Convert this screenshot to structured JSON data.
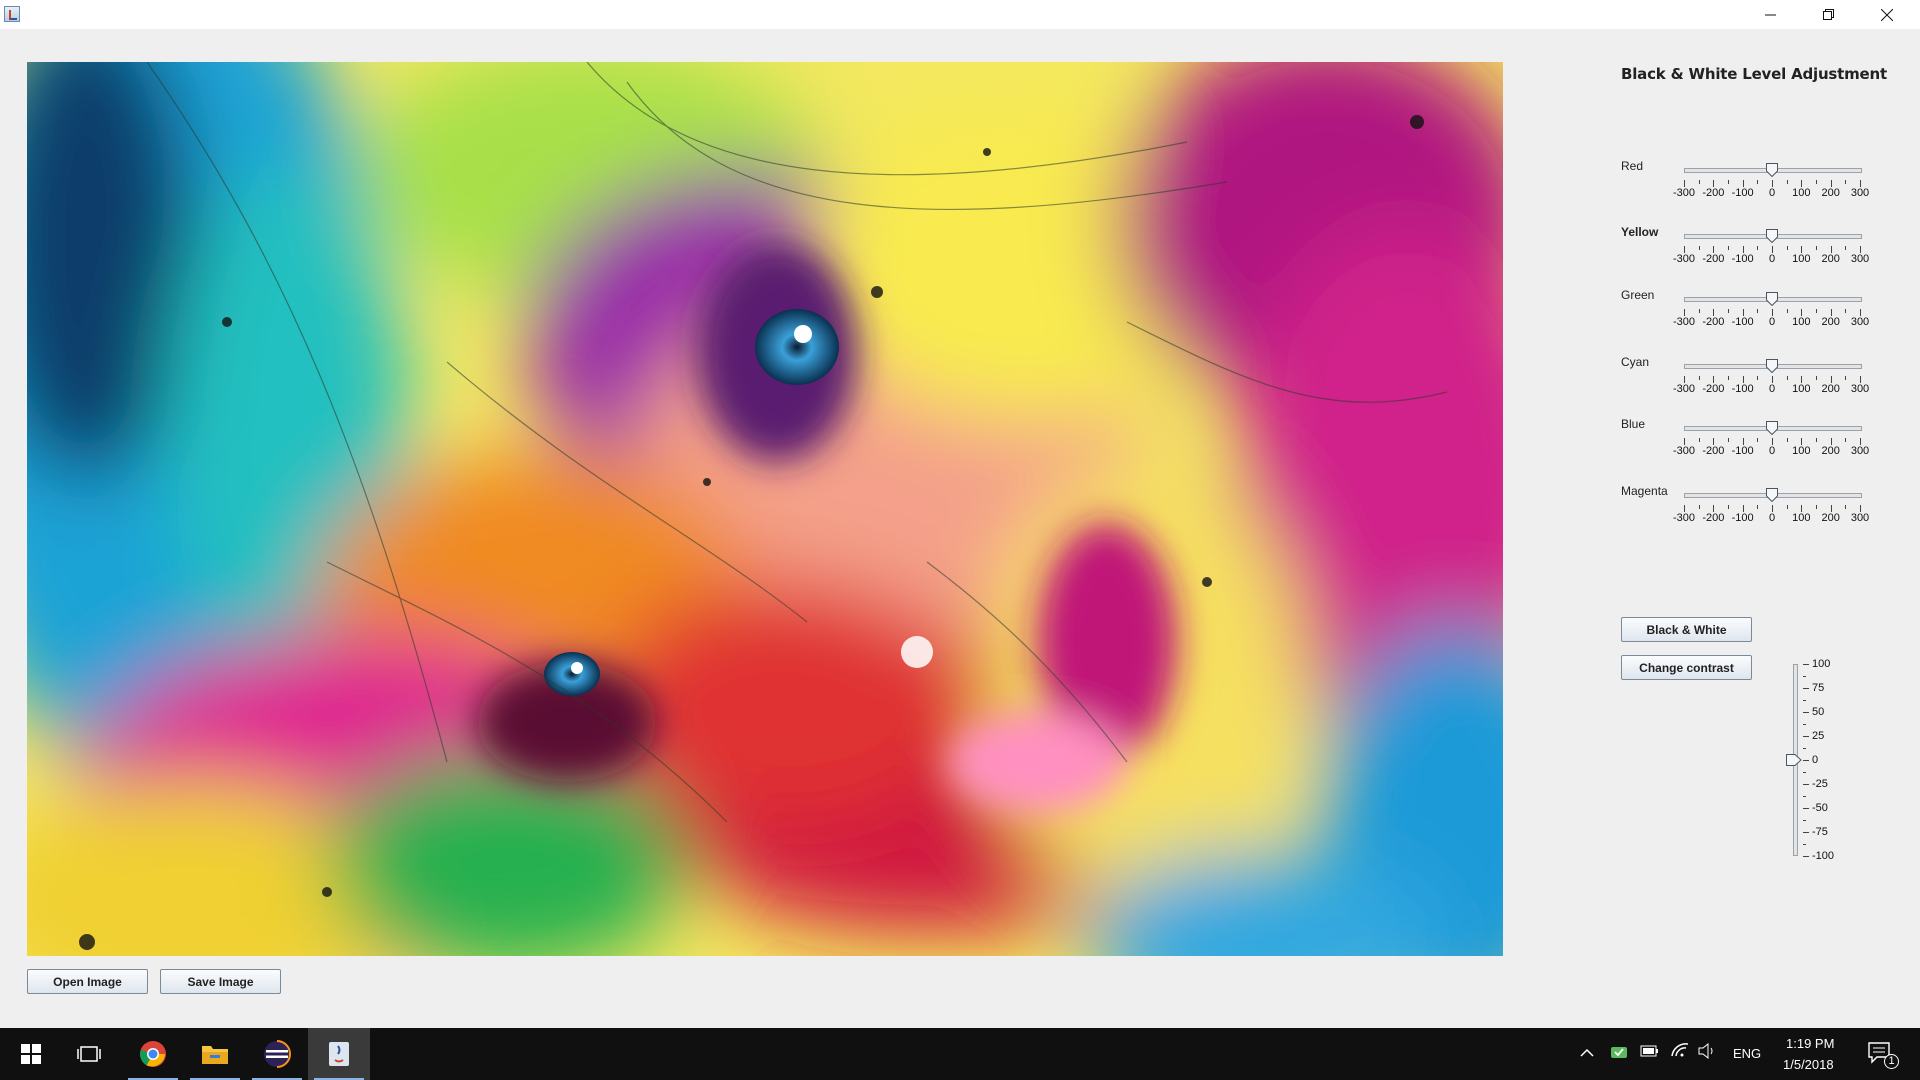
{
  "window": {
    "icon": "java-app-icon",
    "controls": [
      "minimize-icon",
      "restore-icon",
      "close-icon"
    ]
  },
  "image_view": {
    "content": "colorful watercolor portrait painting"
  },
  "bottom_buttons": {
    "open": "Open Image",
    "save": "Save Image"
  },
  "panel": {
    "title": "Black & White Level Adjustment",
    "sliders": [
      {
        "label": "Red",
        "value": 0,
        "bold": false
      },
      {
        "label": "Yellow",
        "value": 0,
        "bold": true
      },
      {
        "label": "Green",
        "value": 0,
        "bold": false
      },
      {
        "label": "Cyan",
        "value": 0,
        "bold": false
      },
      {
        "label": "Blue",
        "value": 0,
        "bold": false
      },
      {
        "label": "Magenta",
        "value": 0,
        "bold": false
      }
    ],
    "slider_min": -300,
    "slider_max": 300,
    "slider_tick_labels": [
      "-300",
      "-200",
      "-100",
      "0",
      "100",
      "200",
      "300"
    ],
    "bw_button": "Black & White",
    "contrast_button": "Change contrast",
    "contrast": {
      "value": 0,
      "min": -100,
      "max": 100,
      "tick_labels": [
        "100",
        "75",
        "50",
        "25",
        "0",
        "-25",
        "-50",
        "-75",
        "-100"
      ]
    }
  },
  "taskbar": {
    "apps": [
      "windows-start-icon",
      "task-view-icon",
      "chrome-icon",
      "file-explorer-icon",
      "eclipse-icon",
      "java-icon"
    ],
    "language": "ENG",
    "time": "1:19 PM",
    "date": "1/5/2018",
    "notification_count": "1"
  },
  "colors": {
    "accent": "#3a73c4",
    "taskbar": "#101010"
  }
}
